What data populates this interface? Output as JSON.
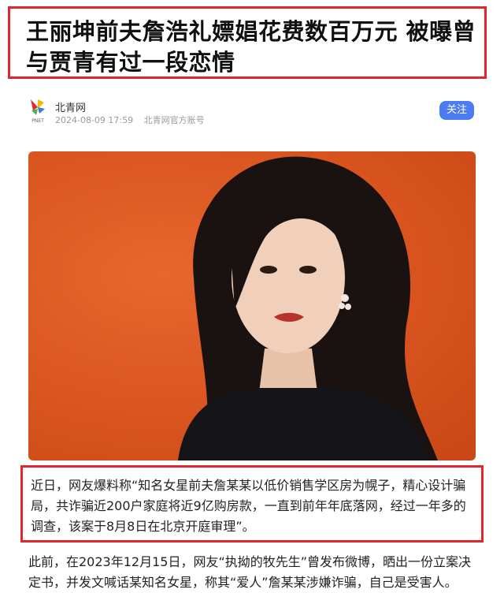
{
  "article": {
    "title": "王丽坤前夫詹浩礼嫖娼花费数百万元 被曝曾与贾青有过一段恋情"
  },
  "author": {
    "logo_text": "PNET",
    "name": "北青网",
    "date": "2024-08-09 17:59",
    "account": "北青网官方账号",
    "follow_label": "关注"
  },
  "photo": {
    "icon": "portrait-photo",
    "background_color": "#d9541f"
  },
  "body": {
    "para1": "近日，网友爆料称“知名女星前夫詹某某以低价销售学区房为幌子，精心设计骗局，共诈骗近200户家庭将近9亿购房款，一直到前年年底落网，经过一年多的调查，该案于8月8日在北京开庭审理”。",
    "para2": "此前，在2023年12月15日，网友“执拗的牧先生”曾发布微博，晒出一份立案决定书，并发文喊话某知名女星，称其“爱人”詹某某涉嫌诈骗，自己是受害人。"
  },
  "colors": {
    "highlight_border": "#e0262f",
    "follow_button": "#4c7cf2"
  }
}
